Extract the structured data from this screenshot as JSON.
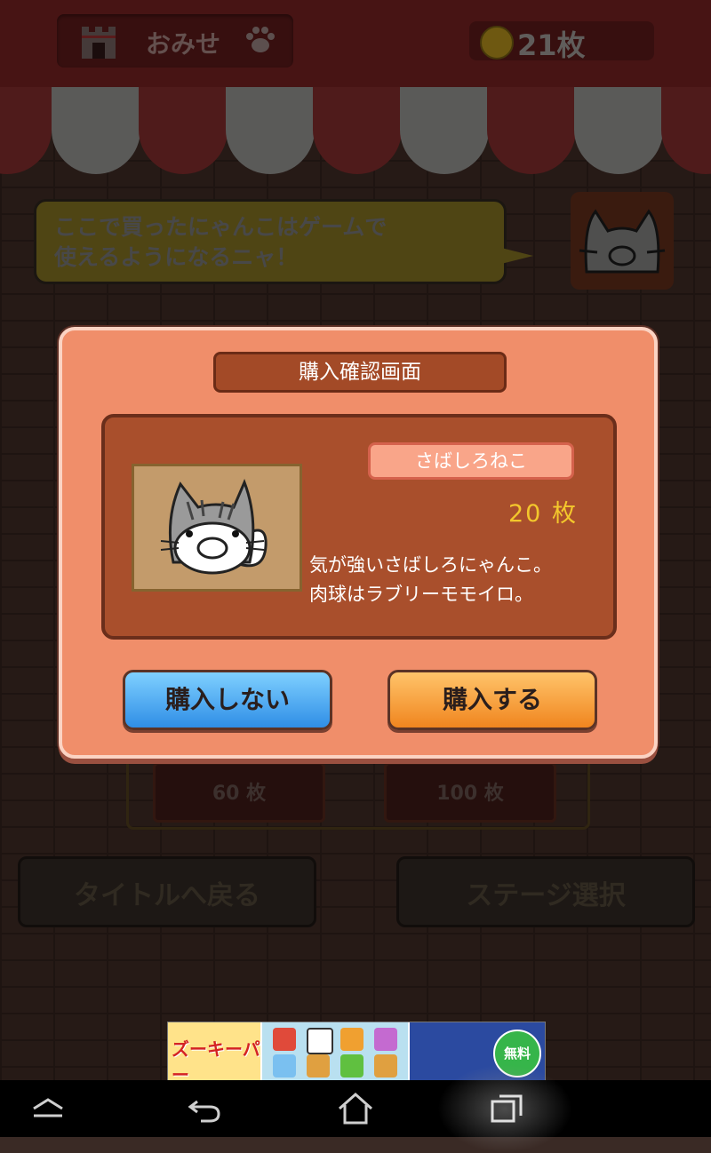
{
  "header": {
    "shop_label": "おみせ",
    "coin_count": "21枚"
  },
  "banner_message": {
    "line1": "ここで買ったにゃんこはゲームで",
    "line2": "使えるようになるニャ！"
  },
  "background_items": {
    "slot_left_price": "60 枚",
    "slot_right_price": "100 枚",
    "back_to_title": "タイトルへ戻る",
    "stage_select": "ステージ選択"
  },
  "dialog": {
    "title": "購入確認画面",
    "item_name": "さばしろねこ",
    "price": "20 枚",
    "desc_line1": "気が強いさばしろにゃんこ。",
    "desc_line2": "肉球はラブリーモモイロ。",
    "cancel_label": "購入しない",
    "confirm_label": "購入する"
  },
  "ad": {
    "logo_text": "ズーキーパー",
    "free_badge": "無料"
  },
  "colors": {
    "dialog_bg": "#f08e6a",
    "panel_bg": "#a94f2c",
    "cancel_button": "#3f9ef0",
    "confirm_button": "#f79a35",
    "price_text": "#f3c72c"
  },
  "navbar": {
    "icons": [
      "home-menu-icon",
      "back-icon",
      "home-icon",
      "recent-apps-icon"
    ]
  }
}
